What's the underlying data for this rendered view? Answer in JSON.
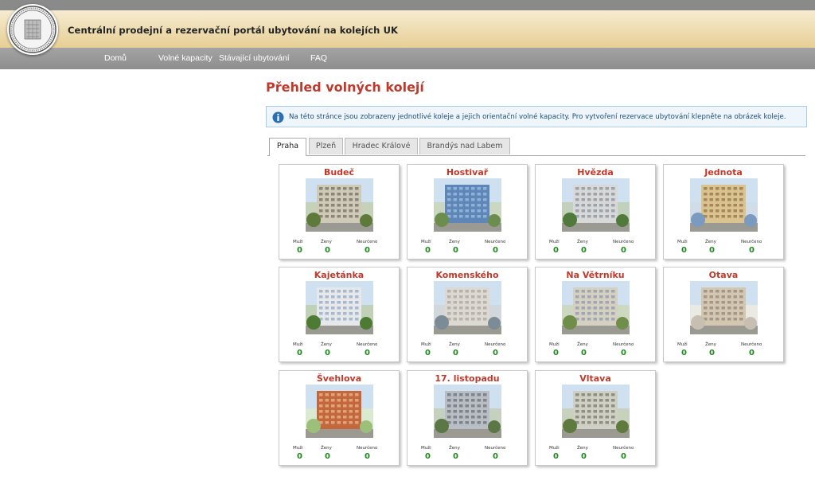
{
  "header": {
    "title": "Centrální prodejní a rezervační portál ubytování na kolejích UK",
    "logo_icon": "university-seal-icon"
  },
  "nav": [
    {
      "label": "Domů"
    },
    {
      "label": "Volné kapacity"
    },
    {
      "label": "Stávající ubytování"
    },
    {
      "label": "FAQ"
    }
  ],
  "page_title": "Přehled volných kolejí",
  "info": {
    "icon": "info-icon",
    "text": "Na této stránce jsou zobrazeny jednotlivé koleje a jejich orientační volné kapacity. Pro vytvoření rezervace ubytování klepněte na obrázek koleje."
  },
  "tabs": [
    {
      "label": "Praha",
      "active": true
    },
    {
      "label": "Plzeň",
      "active": false
    },
    {
      "label": "Hradec Králové",
      "active": false
    },
    {
      "label": "Brandýs nad Labem",
      "active": false
    }
  ],
  "labels": {
    "men": "Muži",
    "women": "Ženy",
    "unspecified": "Neurčeno"
  },
  "dorms": [
    {
      "name": "Budeč",
      "men": "0",
      "women": "0",
      "unspecified": "0"
    },
    {
      "name": "Hostivař",
      "men": "0",
      "women": "0",
      "unspecified": "0"
    },
    {
      "name": "Hvězda",
      "men": "0",
      "women": "0",
      "unspecified": "0"
    },
    {
      "name": "Jednota",
      "men": "0",
      "women": "0",
      "unspecified": "0"
    },
    {
      "name": "Kajetánka",
      "men": "0",
      "women": "0",
      "unspecified": "0"
    },
    {
      "name": "Komenského",
      "men": "0",
      "women": "0",
      "unspecified": "0"
    },
    {
      "name": "Na Větrníku",
      "men": "0",
      "women": "0",
      "unspecified": "0"
    },
    {
      "name": "Otava",
      "men": "0",
      "women": "0",
      "unspecified": "0"
    },
    {
      "name": "Švehlova",
      "men": "0",
      "women": "0",
      "unspecified": "0"
    },
    {
      "name": "17. listopadu",
      "men": "0",
      "women": "0",
      "unspecified": "0"
    },
    {
      "name": "Vltava",
      "men": "0",
      "women": "0",
      "unspecified": "0"
    }
  ]
}
